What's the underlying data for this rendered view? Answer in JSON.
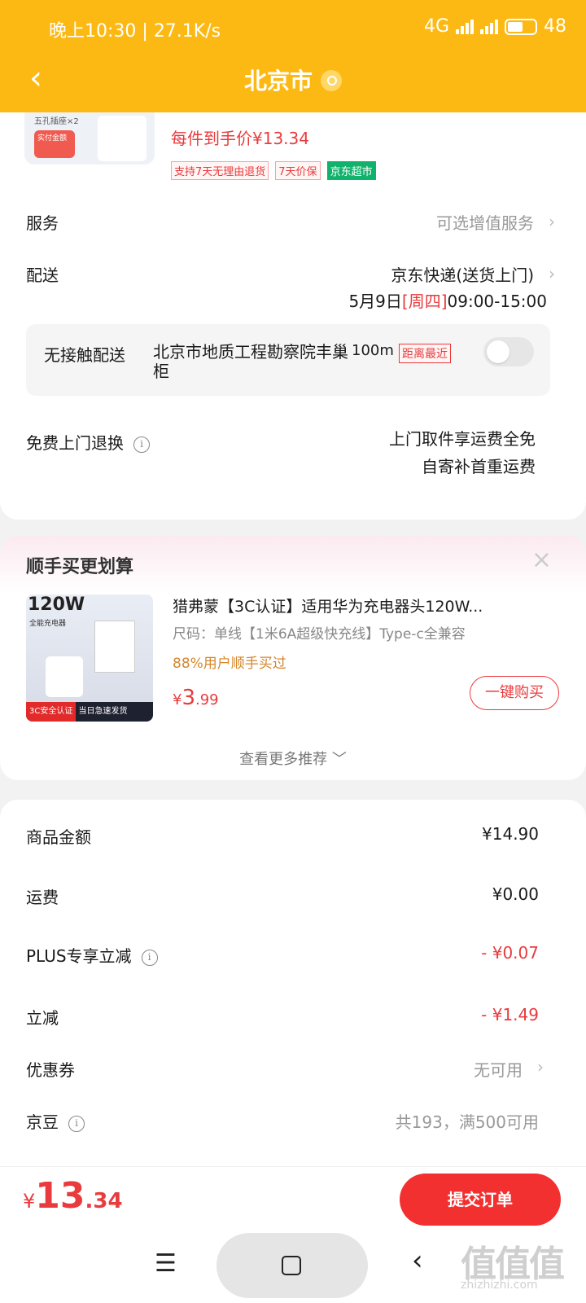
{
  "status_bar": {
    "time": "晚上10:30",
    "speed": "27.1K/s",
    "network": "4G",
    "battery": "48"
  },
  "header": {
    "back_symbol": "‹",
    "title": "北京市"
  },
  "product": {
    "thumb_line1": "五孔插座×2",
    "thumb_badge": "实付金额",
    "price_each": "每件到手价¥13.34",
    "tags": [
      "支持7天无理由退货",
      "7天价保",
      "京东超市"
    ]
  },
  "service": {
    "label": "服务",
    "value": "可选增值服务"
  },
  "delivery": {
    "label": "配送",
    "method": "京东快递(送货上门)",
    "date": "5月9日",
    "weekday": "[周四]",
    "time": "09:00-15:00"
  },
  "contactless": {
    "label": "无接触配送",
    "place": "北京市地质工程勘察院丰巢柜",
    "distance": "100m",
    "badge": "距离最近"
  },
  "returns": {
    "label": "免费上门退换",
    "line1": "上门取件享运费全免",
    "line2": "自寄补首重运费"
  },
  "recommend": {
    "heading": "顺手买更划算",
    "close_symbol": "×",
    "image_power": "120W",
    "image_sub": "全能充电器",
    "image_bar_left": "3C安全认证",
    "image_bar_right": "当日急速发货",
    "title": "猎弗蒙【3C认证】适用华为充电器头120W...",
    "size": "尺码：单线【1米6A超级快充线】Type-c全兼容",
    "bought": "88%用户顺手买过",
    "price_currency": "¥",
    "price_int": "3",
    "price_dec": ".99",
    "buy_label": "一键购买",
    "more": "查看更多推荐 ﹀"
  },
  "fees": {
    "goods_label": "商品金额",
    "goods_value": "¥14.90",
    "shipping_label": "运费",
    "shipping_value": "¥0.00",
    "plus_label": "PLUS专享立减",
    "plus_value": "- ¥0.07",
    "discount_label": "立减",
    "discount_value": "- ¥1.49",
    "coupon_label": "优惠券",
    "coupon_value": "无可用",
    "beans_label": "京豆",
    "beans_value": "共193，满500可用"
  },
  "bottom": {
    "total_currency": "¥",
    "total_int": "13",
    "total_dec": ".34",
    "submit_label": "提交订单"
  },
  "watermark": {
    "main": "值值值",
    "url": "zhizhizhi.com"
  },
  "colors": {
    "header": "#fdb913",
    "accent_red": "#e93b3d",
    "submit_red": "#f23030",
    "green_tag": "#11b26b"
  }
}
